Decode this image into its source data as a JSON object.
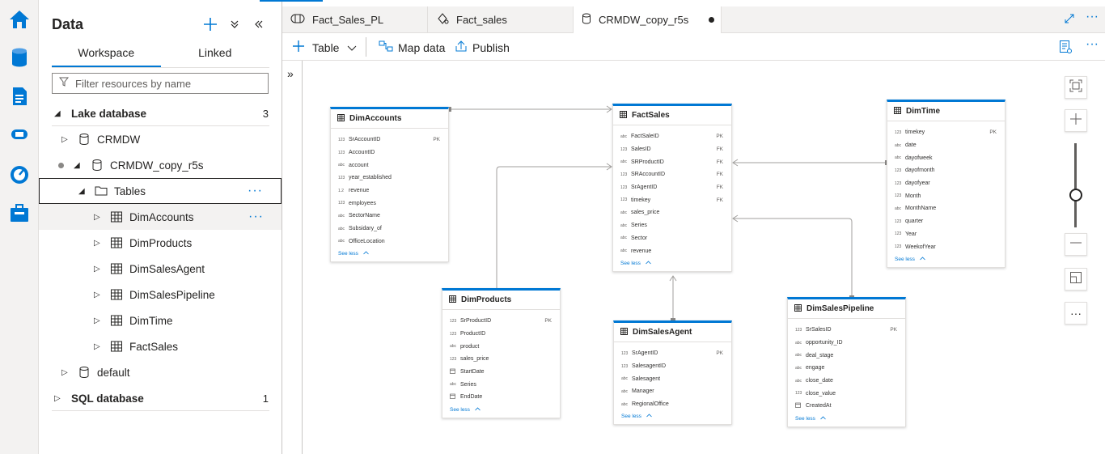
{
  "rail": {
    "icons": [
      "home-icon",
      "data-icon",
      "develop-icon",
      "integrate-icon",
      "monitor-icon",
      "manage-icon"
    ]
  },
  "panel": {
    "title": "Data",
    "tabs": [
      "Workspace",
      "Linked"
    ],
    "filter_placeholder": "Filter resources by name",
    "tree": {
      "lake_database": {
        "label": "Lake database",
        "count": "3"
      },
      "crmdw": "CRMDW",
      "crmdw_copy": "CRMDW_copy_r5s",
      "tables": "Tables",
      "items": [
        "DimAccounts",
        "DimProducts",
        "DimSalesAgent",
        "DimSalesPipeline",
        "DimTime",
        "FactSales"
      ],
      "default": "default",
      "sql_database": {
        "label": "SQL database",
        "count": "1"
      }
    }
  },
  "doc_tabs": [
    {
      "label": "Fact_Sales_PL",
      "icon": "pipeline-icon"
    },
    {
      "label": "Fact_sales",
      "icon": "dataflow-icon"
    },
    {
      "label": "CRMDW_copy_r5s",
      "icon": "database-icon",
      "dirty": true
    }
  ],
  "toolbar": {
    "table": "Table",
    "map_data": "Map data",
    "publish": "Publish"
  },
  "see_less": "See less",
  "tables": {
    "dimaccounts": {
      "name": "DimAccounts",
      "fields": [
        {
          "type": "123",
          "name": "SrAccountID",
          "key": "PK"
        },
        {
          "type": "123",
          "name": "AccountID",
          "key": ""
        },
        {
          "type": "abc",
          "name": "account",
          "key": ""
        },
        {
          "type": "123",
          "name": "year_established",
          "key": ""
        },
        {
          "type": "1.2",
          "name": "revenue",
          "key": ""
        },
        {
          "type": "123",
          "name": "employees",
          "key": ""
        },
        {
          "type": "abc",
          "name": "SectorName",
          "key": ""
        },
        {
          "type": "abc",
          "name": "Subsidary_of",
          "key": ""
        },
        {
          "type": "abc",
          "name": "OfficeLocation",
          "key": ""
        }
      ]
    },
    "factsales": {
      "name": "FactSales",
      "fields": [
        {
          "type": "abc",
          "name": "FactSaleID",
          "key": "PK"
        },
        {
          "type": "123",
          "name": "SalesID",
          "key": "FK"
        },
        {
          "type": "abc",
          "name": "SRProductID",
          "key": "FK"
        },
        {
          "type": "123",
          "name": "SRAccountID",
          "key": "FK"
        },
        {
          "type": "123",
          "name": "SrAgentID",
          "key": "FK"
        },
        {
          "type": "123",
          "name": "timekey",
          "key": "FK"
        },
        {
          "type": "abc",
          "name": "sales_price",
          "key": ""
        },
        {
          "type": "abc",
          "name": "Series",
          "key": ""
        },
        {
          "type": "abc",
          "name": "Sector",
          "key": ""
        },
        {
          "type": "abc",
          "name": "revenue",
          "key": ""
        }
      ]
    },
    "dimtime": {
      "name": "DimTime",
      "fields": [
        {
          "type": "123",
          "name": "timekey",
          "key": "PK"
        },
        {
          "type": "abc",
          "name": "date",
          "key": ""
        },
        {
          "type": "abc",
          "name": "dayofweek",
          "key": ""
        },
        {
          "type": "123",
          "name": "dayofmonth",
          "key": ""
        },
        {
          "type": "123",
          "name": "dayofyear",
          "key": ""
        },
        {
          "type": "123",
          "name": "Month",
          "key": ""
        },
        {
          "type": "abc",
          "name": "MonthName",
          "key": ""
        },
        {
          "type": "123",
          "name": "quarter",
          "key": ""
        },
        {
          "type": "123",
          "name": "Year",
          "key": ""
        },
        {
          "type": "123",
          "name": "WeekofYear",
          "key": ""
        }
      ]
    },
    "dimproducts": {
      "name": "DimProducts",
      "fields": [
        {
          "type": "123",
          "name": "SrProductID",
          "key": "PK"
        },
        {
          "type": "123",
          "name": "ProductID",
          "key": ""
        },
        {
          "type": "abc",
          "name": "product",
          "key": ""
        },
        {
          "type": "123",
          "name": "sales_price",
          "key": ""
        },
        {
          "type": "date",
          "name": "StartDate",
          "key": ""
        },
        {
          "type": "abc",
          "name": "Series",
          "key": ""
        },
        {
          "type": "date",
          "name": "EndDate",
          "key": ""
        }
      ]
    },
    "dimsalesagent": {
      "name": "DimSalesAgent",
      "fields": [
        {
          "type": "123",
          "name": "SrAgentID",
          "key": "PK"
        },
        {
          "type": "123",
          "name": "SalesagentID",
          "key": ""
        },
        {
          "type": "abc",
          "name": "Salesagent",
          "key": ""
        },
        {
          "type": "abc",
          "name": "Manager",
          "key": ""
        },
        {
          "type": "abc",
          "name": "RegionalOffice",
          "key": ""
        }
      ]
    },
    "dimsalespipeline": {
      "name": "DimSalesPipeline",
      "fields": [
        {
          "type": "123",
          "name": "SrSalesID",
          "key": "PK"
        },
        {
          "type": "abc",
          "name": "opportunity_ID",
          "key": ""
        },
        {
          "type": "abc",
          "name": "deal_stage",
          "key": ""
        },
        {
          "type": "abc",
          "name": "engage",
          "key": ""
        },
        {
          "type": "abc",
          "name": "close_date",
          "key": ""
        },
        {
          "type": "123",
          "name": "close_value",
          "key": ""
        },
        {
          "type": "date",
          "name": "CreatedAt",
          "key": ""
        }
      ]
    }
  },
  "colors": {
    "accent": "#0078d4"
  }
}
